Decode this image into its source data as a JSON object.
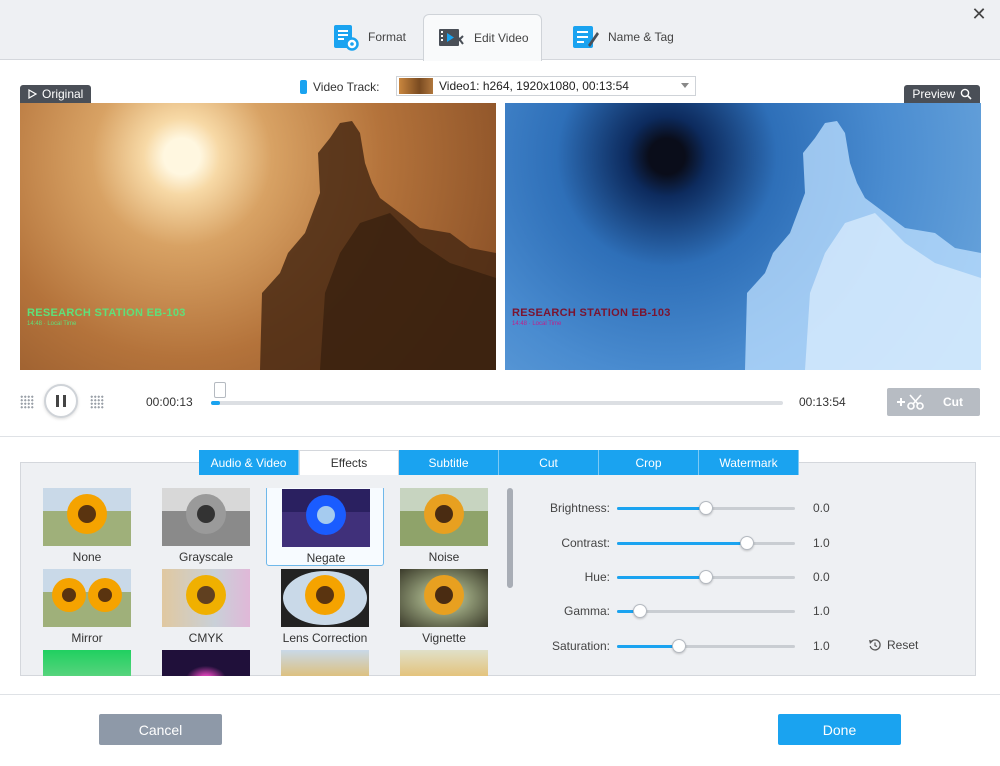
{
  "window": {
    "close_glyph": "✕"
  },
  "top_tabs": [
    {
      "label": "Format",
      "icon": "format-settings-icon"
    },
    {
      "label": "Edit Video",
      "icon": "edit-video-icon",
      "active": true
    },
    {
      "label": "Name & Tag",
      "icon": "name-tag-icon"
    }
  ],
  "video_track": {
    "label": "Video Track:",
    "selected": "Video1: h264, 1920x1080, 00:13:54"
  },
  "panes": {
    "original_label": "Original",
    "preview_label": "Preview",
    "caption": "RESEARCH STATION EB-103",
    "subcaption": "14:48 · Local Time"
  },
  "playback": {
    "current_time": "00:00:13",
    "total_time": "00:13:54",
    "progress": 0.016,
    "cut_label": "Cut"
  },
  "sub_tabs": [
    "Audio & Video",
    "Effects",
    "Subtitle",
    "Cut",
    "Crop",
    "Watermark"
  ],
  "active_sub_tab": "Effects",
  "effects": [
    {
      "label": "None"
    },
    {
      "label": "Grayscale"
    },
    {
      "label": "Negate",
      "selected": true
    },
    {
      "label": "Noise"
    },
    {
      "label": "Mirror"
    },
    {
      "label": "CMYK"
    },
    {
      "label": "Lens Correction"
    },
    {
      "label": "Vignette"
    }
  ],
  "adjustments": [
    {
      "label": "Brightness:",
      "value": "0.0",
      "level": 0.5
    },
    {
      "label": "Contrast:",
      "value": "1.0",
      "level": 0.73
    },
    {
      "label": "Hue:",
      "value": "0.0",
      "level": 0.5
    },
    {
      "label": "Gamma:",
      "value": "1.0",
      "level": 0.13
    },
    {
      "label": "Saturation:",
      "value": "1.0",
      "level": 0.35
    }
  ],
  "reset_label": "Reset",
  "footer": {
    "cancel": "Cancel",
    "done": "Done"
  },
  "colors": {
    "accent": "#1aa3f0",
    "cancel": "#8e99a8",
    "pane_label": "#4a4f57"
  }
}
